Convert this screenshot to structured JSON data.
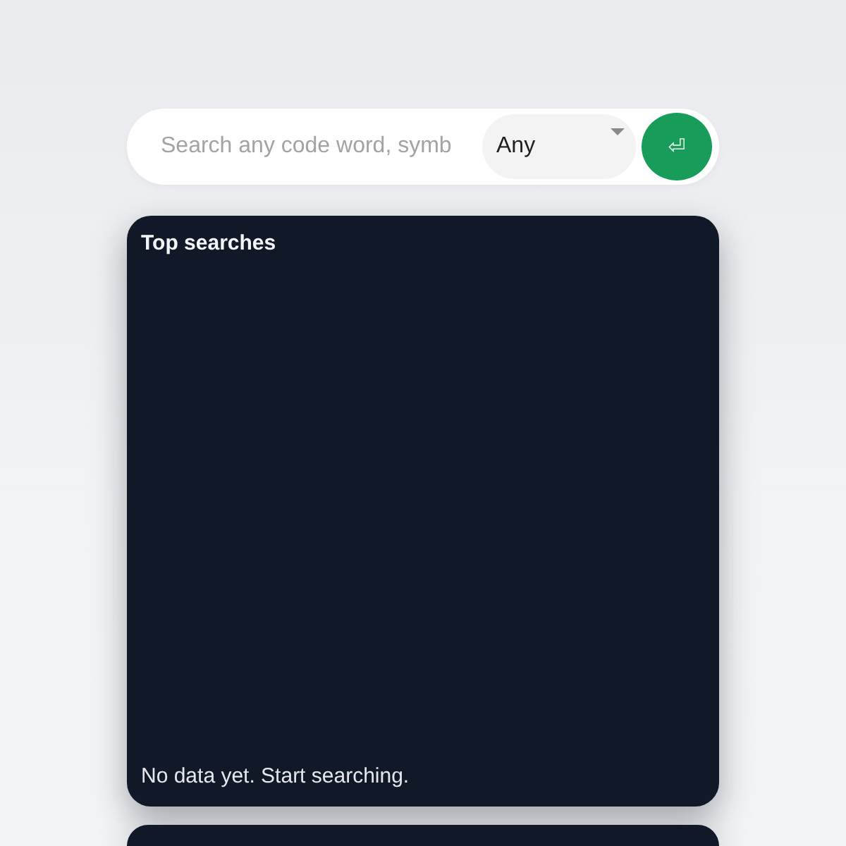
{
  "search": {
    "placeholder": "Search any code word, symb",
    "filter": {
      "value": "Any"
    },
    "submit": {
      "label": "⏎"
    }
  },
  "panels": [
    {
      "kind": "full",
      "title": "Top searches",
      "empty_message": "No data yet. Start searching."
    },
    {
      "kind": "clipped"
    }
  ]
}
